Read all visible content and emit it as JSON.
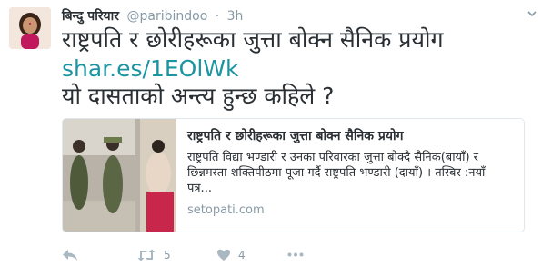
{
  "author": {
    "name": "बिन्दु परियार",
    "handle": "@paribindoo",
    "separator": "·",
    "time": "3h"
  },
  "tweet": {
    "line1": "राष्ट्रपति र छोरीहरूका जुत्ता बोक्न सैनिक प्रयोग",
    "link": "shar.es/1EOlWk",
    "line3": "यो दासताको अन्त्य हुन्छ कहिले ?"
  },
  "card": {
    "title": "राष्ट्रपति र छोरीहरूका जुत्ता बोक्न सैनिक प्रयोग",
    "description": "राष्ट्रपति विद्या भण्डारी र उनका परिवारका जुत्ता बोक्दै सैनिक(बायाँ) र छिन्नमस्ता शक्तिपीठमा पूजा गर्दै राष्ट्रपति भण्डारी (दायाँ) । तस्बिर :नयाँ पत्र...",
    "domain": "setopati.com"
  },
  "actions": {
    "retweet_count": "5",
    "like_count": "4"
  },
  "icons": {
    "reply": "reply-icon",
    "retweet": "retweet-icon",
    "like": "heart-icon",
    "more": "more-icon",
    "caret": "chevron-down-icon"
  },
  "colors": {
    "text": "#292f33",
    "muted": "#8899a6",
    "link": "#1b95a1",
    "border": "#e1e8ed",
    "icon": "#aab8c2"
  }
}
